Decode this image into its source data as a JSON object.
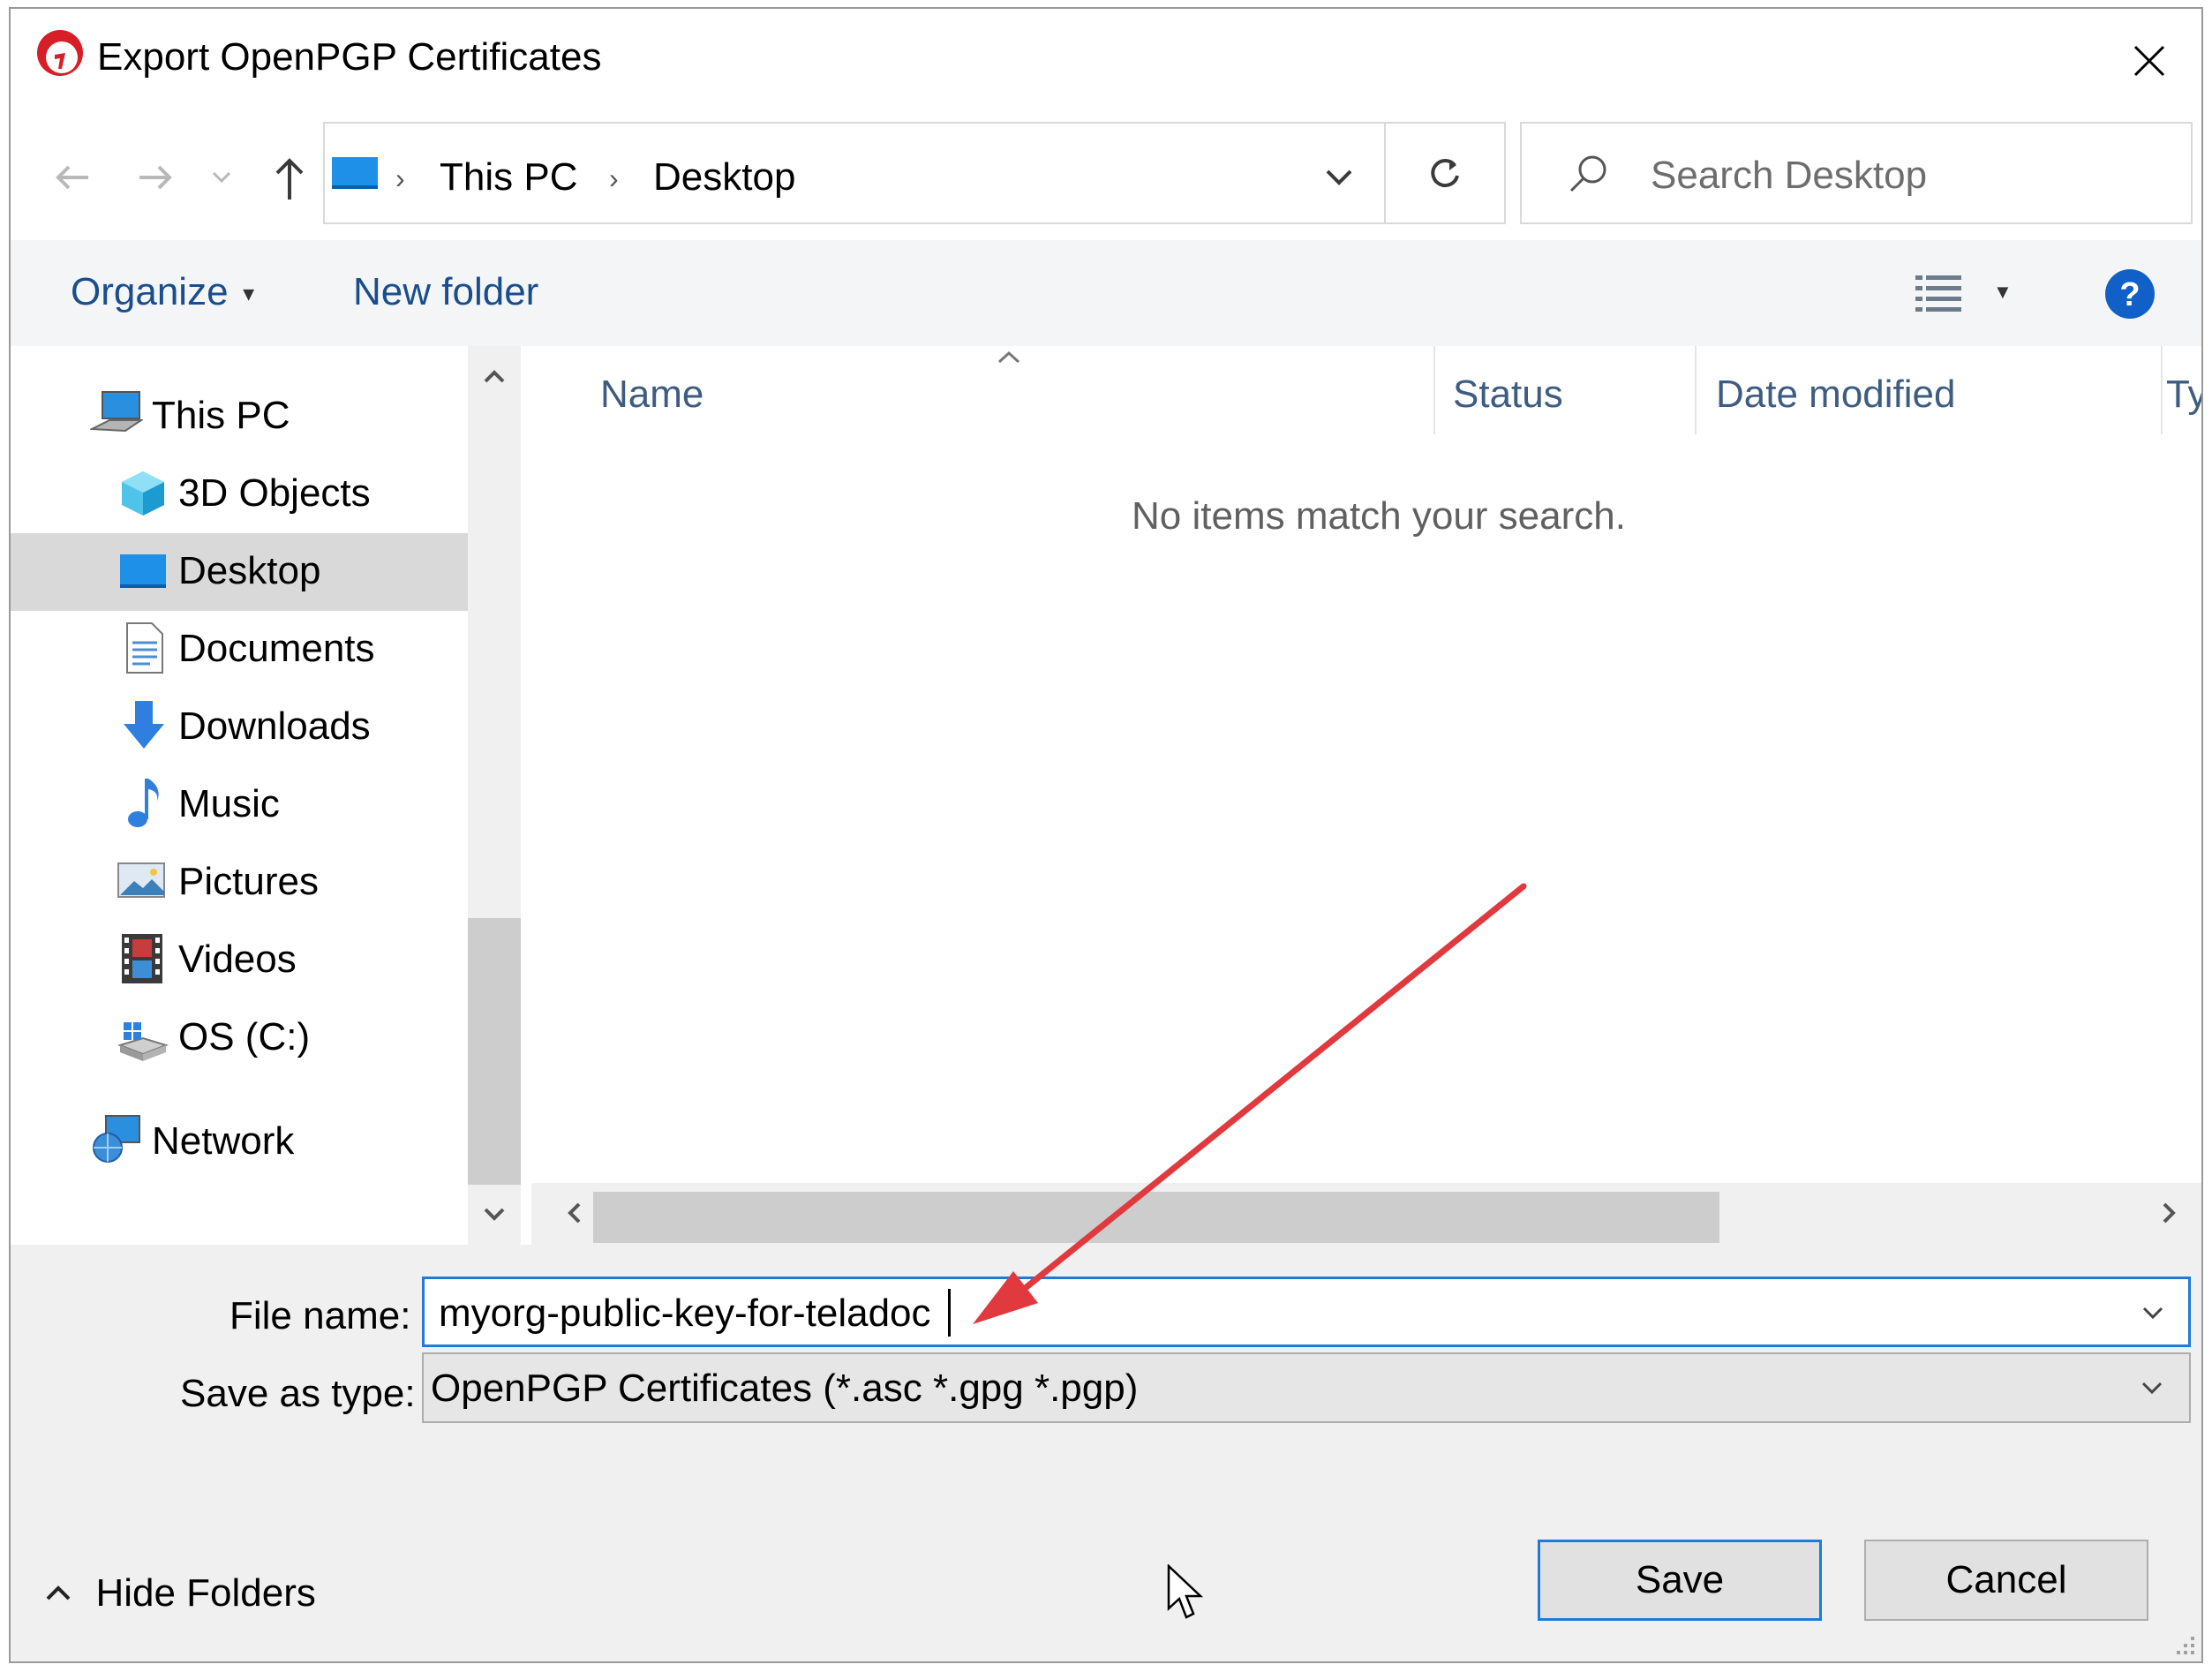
{
  "window": {
    "title": "Export OpenPGP Certificates"
  },
  "nav": {
    "breadcrumb": [
      "This PC",
      "Desktop"
    ],
    "search_placeholder": "Search Desktop"
  },
  "toolbar": {
    "organize_label": "Organize",
    "new_folder_label": "New folder"
  },
  "sidebar": {
    "items": [
      {
        "label": "This PC",
        "icon": "computer-icon"
      },
      {
        "label": "3D Objects",
        "icon": "3d-objects-icon"
      },
      {
        "label": "Desktop",
        "icon": "desktop-icon",
        "selected": true
      },
      {
        "label": "Documents",
        "icon": "documents-icon"
      },
      {
        "label": "Downloads",
        "icon": "downloads-icon"
      },
      {
        "label": "Music",
        "icon": "music-icon"
      },
      {
        "label": "Pictures",
        "icon": "pictures-icon"
      },
      {
        "label": "Videos",
        "icon": "videos-icon"
      },
      {
        "label": "OS (C:)",
        "icon": "drive-icon"
      },
      {
        "label": "Network",
        "icon": "network-icon"
      }
    ]
  },
  "file_list": {
    "columns": [
      "Name",
      "Status",
      "Date modified",
      "Ty"
    ],
    "empty_message": "No items match your search."
  },
  "form": {
    "file_name_label": "File name:",
    "file_name_value": "myorg-public-key-for-teladoc",
    "save_as_type_label": "Save as type:",
    "save_as_type_value": "OpenPGP Certificates (*.asc *.gpg *.pgp)"
  },
  "footer": {
    "hide_folders_label": "Hide Folders",
    "save_label": "Save",
    "cancel_label": "Cancel"
  },
  "colors": {
    "accent": "#1e7bd9",
    "annotation_arrow": "#e0393e",
    "link_text": "#1a4d8c"
  }
}
